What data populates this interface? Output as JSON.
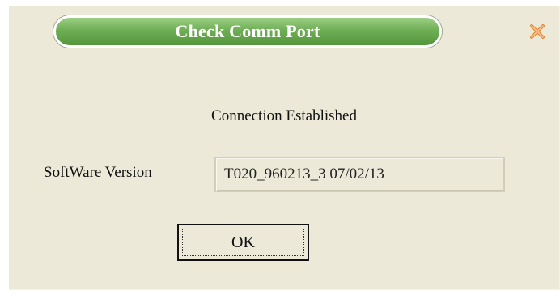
{
  "dialog": {
    "title": "Check Comm Port",
    "close_icon": "close-x-icon",
    "status_text": "Connection Established",
    "software_version_label": "SoftWare Version",
    "software_version_value": "T020_960213_3 07/02/13",
    "ok_label": "OK"
  },
  "colors": {
    "dialog_background": "#ece9d8",
    "title_green": "#6fae55",
    "close_icon": "#f0a050"
  }
}
